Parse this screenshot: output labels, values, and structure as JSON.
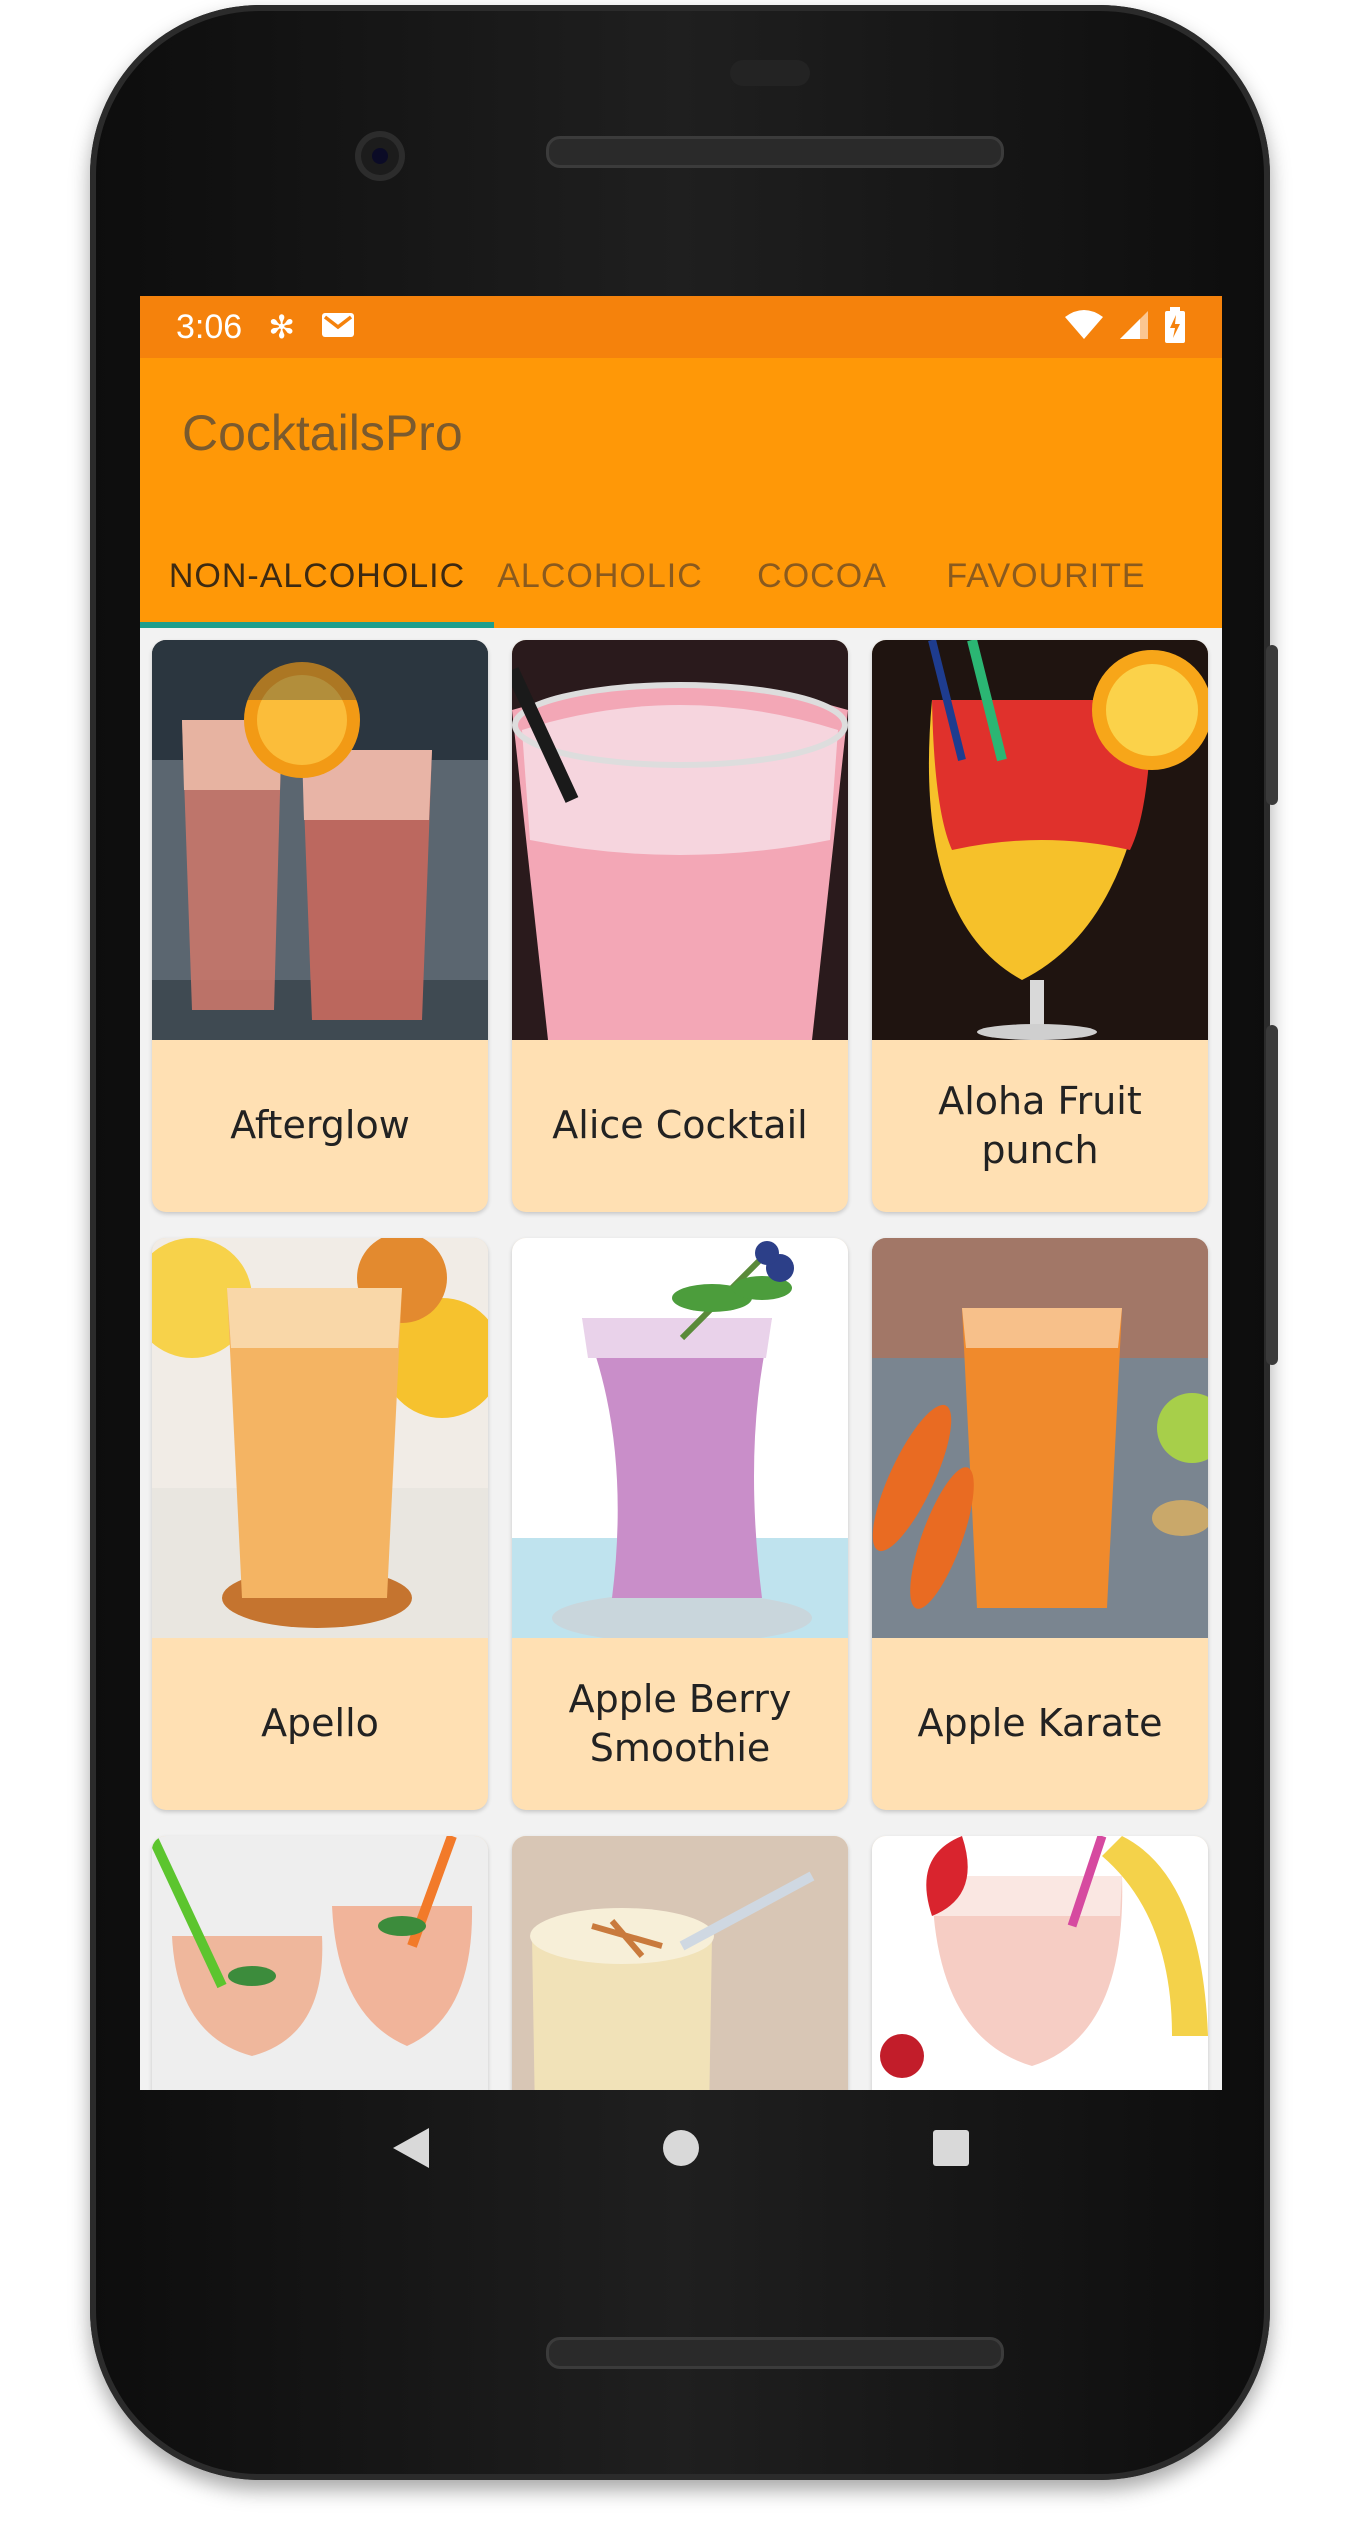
{
  "status_bar": {
    "time": "3:06",
    "icons_left": [
      "snowflake-icon",
      "gmail-icon"
    ],
    "icons_right": [
      "wifi-icon",
      "signal-icon",
      "battery-charging-icon"
    ]
  },
  "app_bar": {
    "title": "CocktailsPro",
    "background": "#ff9807",
    "status_background": "#f5820c"
  },
  "tabs": [
    {
      "label": "NON-ALCOHOLIC",
      "active": true
    },
    {
      "label": "ALCOHOLIC",
      "active": false
    },
    {
      "label": "COCOA",
      "active": false
    },
    {
      "label": "FAVOURITE",
      "active": false
    }
  ],
  "tab_indicator_color": "#1e9e8c",
  "drinks": [
    {
      "name": "Afterglow"
    },
    {
      "name": "Alice Cocktail"
    },
    {
      "name": "Aloha Fruit punch"
    },
    {
      "name": "Apello"
    },
    {
      "name": "Apple Berry Smoothie"
    },
    {
      "name": "Apple Karate"
    },
    {
      "name": ""
    },
    {
      "name": ""
    },
    {
      "name": ""
    }
  ],
  "card_label_background": "#ffe0b3",
  "navigation": [
    "back-icon",
    "home-icon",
    "recents-icon"
  ]
}
